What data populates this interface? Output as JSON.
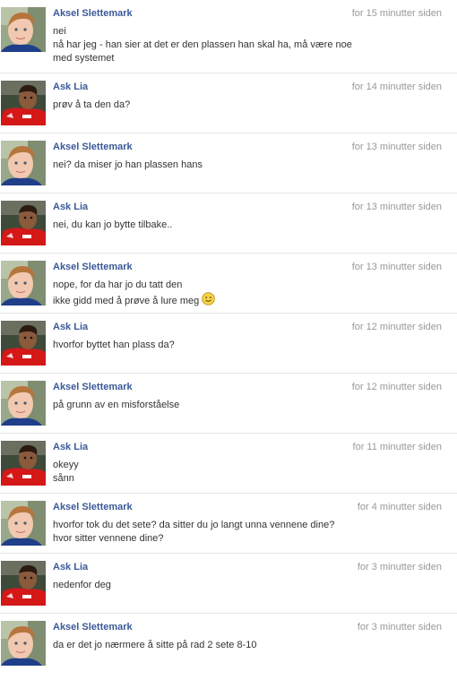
{
  "messages": [
    {
      "author": "Aksel Slettemark",
      "avatar": "user-avatar-boy",
      "time": "for 15 minutter siden",
      "lines": [
        "nei",
        "nå har jeg - han sier at det er den plassen han skal ha, må være noe",
        "med systemet"
      ]
    },
    {
      "author": "Ask Lia",
      "avatar": "user-avatar-footballer",
      "time": "for 14 minutter siden",
      "lines": [
        "prøv å ta den da?"
      ]
    },
    {
      "author": "Aksel Slettemark",
      "avatar": "user-avatar-boy",
      "time": "for 13 minutter siden",
      "lines": [
        "nei? da miser jo han plassen hans"
      ]
    },
    {
      "author": "Ask Lia",
      "avatar": "user-avatar-footballer",
      "time": "for 13 minutter siden",
      "lines": [
        "nei, du kan jo bytte tilbake.."
      ]
    },
    {
      "author": "Aksel Slettemark",
      "avatar": "user-avatar-boy",
      "time": "for 13 minutter siden",
      "lines": [
        "nope, for da har jo du tatt den",
        "ikke gidd med å prøve å lure meg"
      ],
      "smiley": "smiley-icon"
    },
    {
      "author": "Ask Lia",
      "avatar": "user-avatar-footballer",
      "time": "for 12 minutter siden",
      "lines": [
        "hvorfor byttet han plass da?"
      ]
    },
    {
      "author": "Aksel Slettemark",
      "avatar": "user-avatar-boy",
      "time": "for 12 minutter siden",
      "lines": [
        "på grunn av en misforståelse"
      ]
    },
    {
      "author": "Ask Lia",
      "avatar": "user-avatar-footballer",
      "time": "for 11 minutter siden",
      "lines": [
        "okeyy",
        "sånn"
      ]
    },
    {
      "author": "Aksel Slettemark",
      "avatar": "user-avatar-boy",
      "time": "for 4 minutter siden",
      "lines": [
        "hvorfor tok du det sete? da sitter du jo langt unna vennene dine?",
        "hvor sitter vennene dine?"
      ]
    },
    {
      "author": "Ask Lia",
      "avatar": "user-avatar-footballer",
      "time": "for 3 minutter siden",
      "lines": [
        "nedenfor deg"
      ]
    },
    {
      "author": "Aksel Slettemark",
      "avatar": "user-avatar-boy",
      "time": "for 3 minutter siden",
      "lines": [
        "da er det jo nærmere å sitte på rad 2 sete 8-10"
      ]
    }
  ],
  "colors": {
    "author": "#3b5998",
    "time": "#999999",
    "text": "#333333",
    "divider": "#e5e5e5"
  }
}
